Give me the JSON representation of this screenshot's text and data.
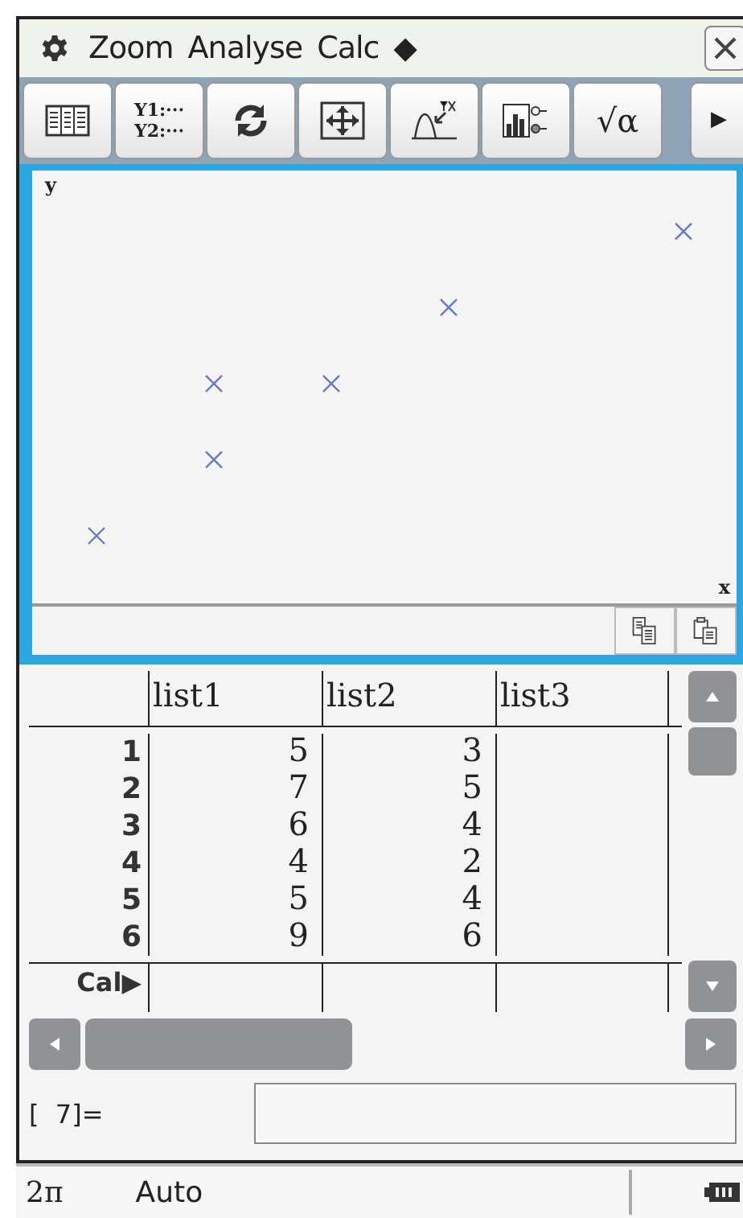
{
  "menu": {
    "items": [
      "Zoom",
      "Analyse",
      "Calc",
      "◆"
    ]
  },
  "toolbar": {
    "buttons": [
      {
        "kind": "table"
      },
      {
        "kind": "lines",
        "lines": [
          "Y1:···",
          "Y2:···"
        ]
      },
      {
        "kind": "refresh"
      },
      {
        "kind": "resize"
      },
      {
        "kind": "trace"
      },
      {
        "kind": "stat"
      },
      {
        "kind": "text",
        "text": "√α"
      },
      {
        "kind": "text",
        "text": "▶"
      }
    ]
  },
  "graph": {
    "y_label": "y",
    "x_label": "x"
  },
  "table": {
    "columns": [
      "list1",
      "list2",
      "list3"
    ],
    "rows": [
      {
        "index": "1",
        "cells": [
          "5",
          "3"
        ]
      },
      {
        "index": "2",
        "cells": [
          "7",
          "5"
        ]
      },
      {
        "index": "3",
        "cells": [
          "6",
          "4"
        ]
      },
      {
        "index": "4",
        "cells": [
          "4",
          "2"
        ]
      },
      {
        "index": "5",
        "cells": [
          "5",
          "4"
        ]
      },
      {
        "index": "6",
        "cells": [
          "9",
          "6"
        ]
      }
    ],
    "footer": "Cal▶"
  },
  "entry": {
    "label": "[  7]="
  },
  "status_bar": {
    "angle": "2π",
    "mode": "Auto"
  }
}
